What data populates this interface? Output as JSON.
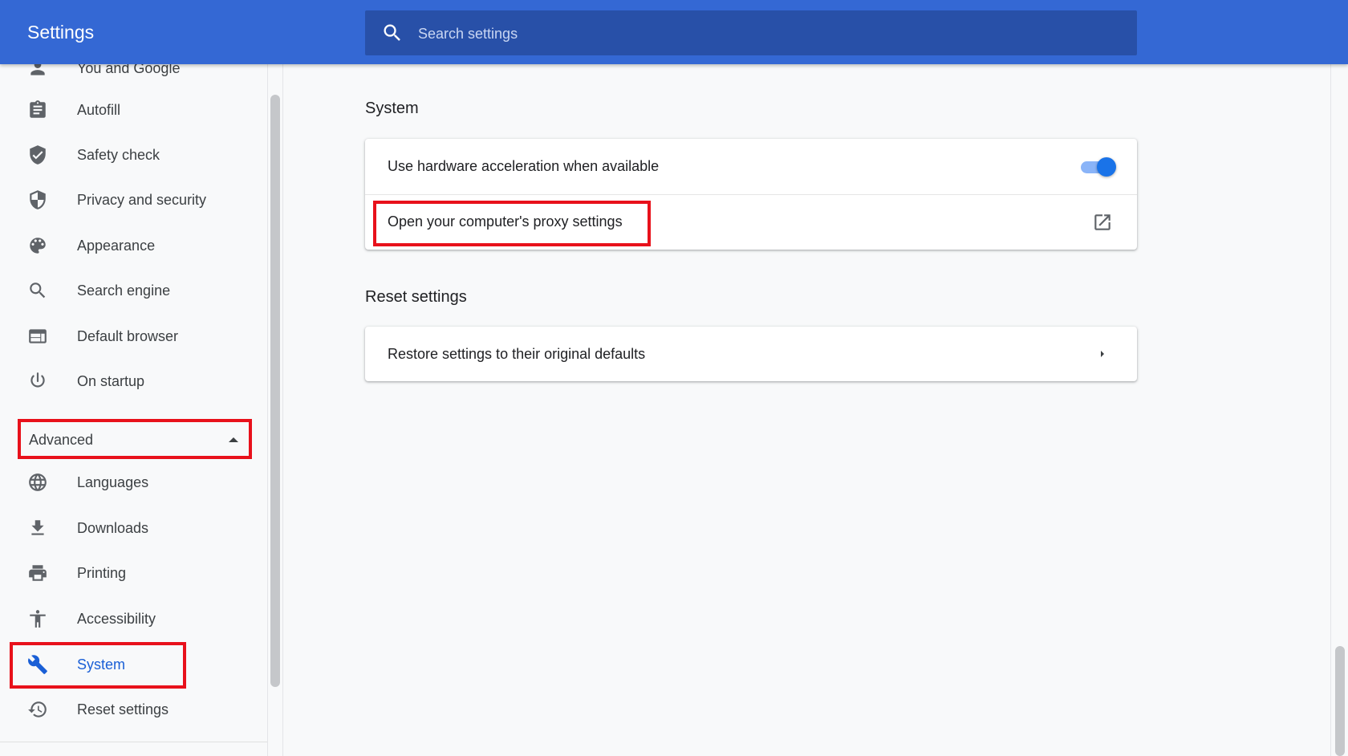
{
  "header": {
    "title": "Settings",
    "search": {
      "placeholder": "Search settings",
      "value": ""
    }
  },
  "sidebar": {
    "items": [
      {
        "label": "You and Google",
        "icon": "person-icon"
      },
      {
        "label": "Autofill",
        "icon": "clipboard-icon"
      },
      {
        "label": "Safety check",
        "icon": "shield-check-icon"
      },
      {
        "label": "Privacy and security",
        "icon": "shield-icon"
      },
      {
        "label": "Appearance",
        "icon": "palette-icon"
      },
      {
        "label": "Search engine",
        "icon": "search-icon"
      },
      {
        "label": "Default browser",
        "icon": "browser-window-icon"
      },
      {
        "label": "On startup",
        "icon": "power-icon"
      }
    ],
    "advanced": {
      "label": "Advanced",
      "expanded": true
    },
    "advanced_items": [
      {
        "label": "Languages",
        "icon": "globe-icon"
      },
      {
        "label": "Downloads",
        "icon": "download-icon"
      },
      {
        "label": "Printing",
        "icon": "printer-icon"
      },
      {
        "label": "Accessibility",
        "icon": "accessibility-icon"
      },
      {
        "label": "System",
        "icon": "wrench-icon",
        "active": true
      },
      {
        "label": "Reset settings",
        "icon": "history-icon"
      }
    ]
  },
  "main": {
    "system": {
      "title": "System",
      "hardware_acceleration": {
        "label": "Use hardware acceleration when available",
        "enabled": true
      },
      "proxy": {
        "label": "Open your computer's proxy settings",
        "icon": "open-in-new-icon"
      }
    },
    "reset": {
      "title": "Reset settings",
      "restore": {
        "label": "Restore settings to their original defaults",
        "icon": "chevron-right-icon"
      }
    }
  },
  "colors": {
    "header": "#3468d4",
    "search_box": "#2850a8",
    "accent": "#1a73e8",
    "highlight": "#e8111b"
  }
}
